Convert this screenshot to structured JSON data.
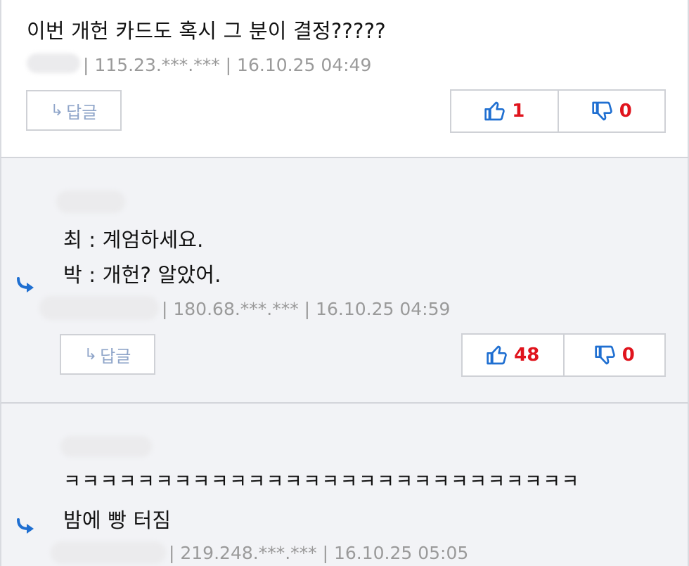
{
  "comments": [
    {
      "lines": [
        "이번 개헌 카드도 혹시 그 분이 결정?????"
      ],
      "meta": "| 115.23.***.*** | 16.10.25 04:49",
      "reply_label": "답글",
      "likes": "1",
      "dislikes": "0"
    },
    {
      "lines": [
        "최 : 계엄하세요.",
        "박 : 개헌? 알았어."
      ],
      "meta": "| 180.68.***.*** | 16.10.25 04:59",
      "reply_label": "답글",
      "likes": "48",
      "dislikes": "0"
    },
    {
      "lines": [
        "ㅋㅋㅋㅋㅋㅋㅋㅋㅋㅋㅋㅋㅋㅋㅋㅋㅋㅋㅋㅋㅋㅋㅋㅋㅋㅋㅋㅋ",
        "밤에 빵 터짐"
      ],
      "meta": "| 219.248.***.*** | 16.10.25 05:05"
    }
  ],
  "colors": {
    "accent_blue": "#1f6fd1",
    "vote_count_red": "#e0141d",
    "reply_text": "#8fa5c9",
    "meta_gray": "#9a9a9a"
  },
  "icons": {
    "reply": "return-arrow-icon",
    "like": "thumbs-up-icon",
    "dislike": "thumbs-down-icon",
    "nested_reply": "curved-arrow-icon"
  }
}
